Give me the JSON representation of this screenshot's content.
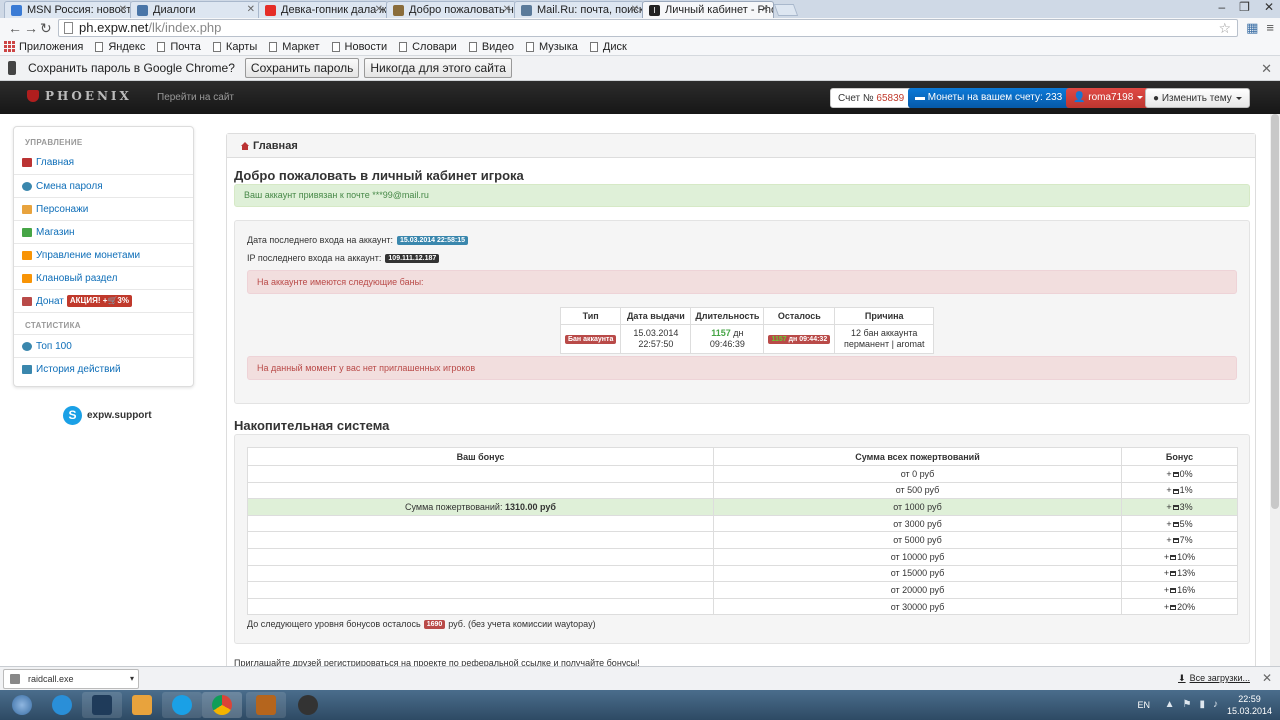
{
  "browser": {
    "tabs": [
      {
        "title": "MSN Россия: новости, зн",
        "fav_color": "#3a7bd5"
      },
      {
        "title": "Диалоги",
        "fav_color": "#4a76a8"
      },
      {
        "title": "Девка-гопник дала журн",
        "fav_color": "#e52d27"
      },
      {
        "title": "Добро пожаловать на Yo",
        "fav_color": "#8a6d3b"
      },
      {
        "title": "Mail.Ru: почта, поиск в и",
        "fav_color": "#5a7a9a"
      },
      {
        "title": "Личный кабинет - Phoen",
        "fav_color": "#222222"
      }
    ],
    "url_domain": "ph.expw.net",
    "url_path": "/lk/index.php",
    "bookmarks": [
      "Приложения",
      "Яндекс",
      "Почта",
      "Карты",
      "Маркет",
      "Новости",
      "Словари",
      "Видео",
      "Музыка",
      "Диск"
    ],
    "password_bar": {
      "text": "Сохранить пароль в Google Chrome?",
      "save": "Сохранить пароль",
      "never": "Никогда для этого сайта"
    }
  },
  "navbar": {
    "brand": "PHOENIX",
    "site_link": "Перейти на сайт",
    "score_label": "Счет №",
    "score_number": "65839",
    "coins_label": "Монеты на вашем счету:",
    "coins_value": "233",
    "user": "roma7198",
    "theme": "Изменить тему"
  },
  "sidebar": {
    "section1": "УПРАВЛЕНИЕ",
    "items1": [
      {
        "label": "Главная",
        "icon_color": "#b33"
      },
      {
        "label": "Смена пароля",
        "icon_color": "#3a87ad"
      },
      {
        "label": "Персонажи",
        "icon_color": "#e8a33d"
      },
      {
        "label": "Магазин",
        "icon_color": "#46a546"
      },
      {
        "label": "Управление монетами",
        "icon_color": "#f89406"
      },
      {
        "label": "Клановый раздел",
        "icon_color": "#f89406"
      },
      {
        "label": "Донат",
        "icon_color": "#b94a48"
      }
    ],
    "promo_badge": "АКЦИЯ! +🛒3%",
    "section2": "СТАТИСТИКА",
    "items2": [
      {
        "label": "Топ 100",
        "icon_color": "#3a87ad"
      },
      {
        "label": "История действий",
        "icon_color": "#3a87ad"
      }
    ],
    "skype": "expw.support"
  },
  "main": {
    "breadcrumb": "Главная",
    "welcome_title": "Добро пожаловать в личный кабинет игрока",
    "email_notice": "Ваш аккаунт привязан к почте ***99@mail.ru",
    "last_login_label": "Дата последнего входа на аккаунт:",
    "last_login_value": "15.03.2014 22:58:15",
    "last_ip_label": "IP последнего входа на аккаунт:",
    "last_ip_value": "109.111.12.187",
    "bans_notice": "На аккаунте имеются следующие баны:",
    "ban_table": {
      "headers": [
        "Тип",
        "Дата выдачи",
        "Длительность",
        "Осталось",
        "Причина"
      ],
      "row": {
        "type": "Бан аккаунта",
        "issued_date": "15.03.2014",
        "issued_time": "22:57:50",
        "duration_days": "1157",
        "duration_unit": "дн",
        "duration_time": "09:46:39",
        "remaining_days": "1157",
        "remaining_rest": "дн 09:44:32",
        "reason1": "12 бан аккаунта",
        "reason2": "перманент | aromat"
      }
    },
    "invited_notice": "На данный момент у вас нет приглашенных игроков",
    "accum_title": "Накопительная система",
    "bonus_table": {
      "headers": [
        "Ваш бонус",
        "Сумма всех пожертвований",
        "Бонус"
      ],
      "donated_label": "Сумма пожертвований:",
      "donated_value": "1310.00 руб",
      "rows": [
        {
          "sum": "от 0 руб",
          "bonus": "0%"
        },
        {
          "sum": "от 500 руб",
          "bonus": "1%"
        },
        {
          "sum": "от 1000 руб",
          "bonus": "3%"
        },
        {
          "sum": "от 3000 руб",
          "bonus": "5%"
        },
        {
          "sum": "от 5000 руб",
          "bonus": "7%"
        },
        {
          "sum": "от 10000 руб",
          "bonus": "10%"
        },
        {
          "sum": "от 15000 руб",
          "bonus": "13%"
        },
        {
          "sum": "от 20000 руб",
          "bonus": "16%"
        },
        {
          "sum": "от 30000 руб",
          "bonus": "20%"
        }
      ]
    },
    "next_level_prefix": "До следующего уровня бонусов осталось",
    "next_level_value": "1690",
    "next_level_suffix": "руб. (без учета комиссии waytopay)",
    "invite_text": "Приглашайте друзей регистрироваться на проекте по реферальной ссылке и получайте бонусы!"
  },
  "downloads": {
    "file": "raidcall.exe",
    "all": "Все загрузки..."
  },
  "taskbar": {
    "lang": "EN",
    "time": "22:59",
    "date": "15.03.2014"
  }
}
